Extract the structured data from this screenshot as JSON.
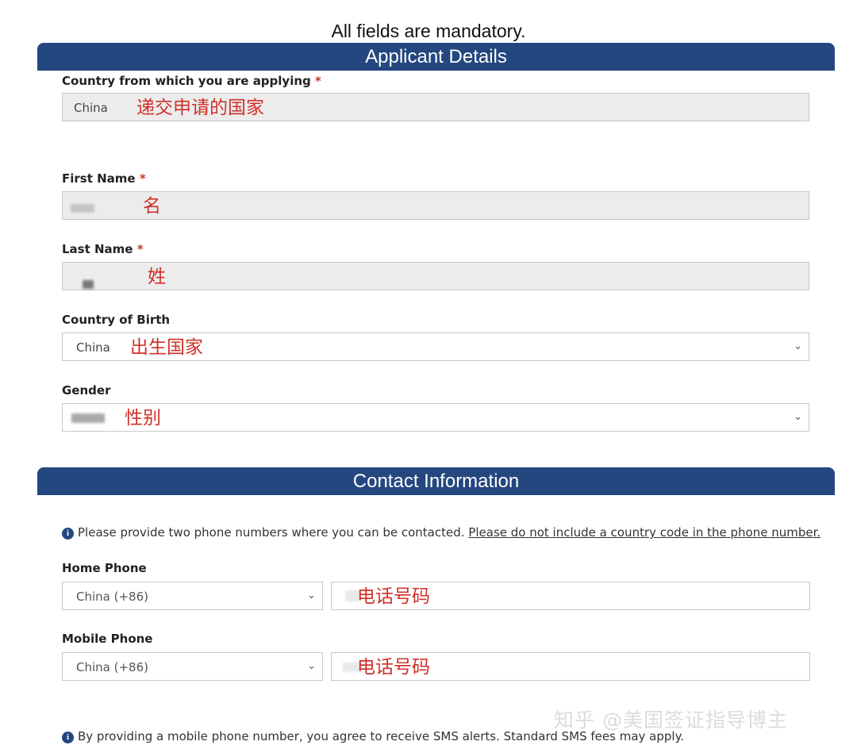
{
  "header": {
    "mandatory_note": "All fields are mandatory."
  },
  "applicant": {
    "section_title": "Applicant Details",
    "country_applying": {
      "label": "Country from which you are applying",
      "required_mark": "*",
      "value": "China",
      "annotation": "递交申请的国家"
    },
    "first_name": {
      "label": "First Name",
      "required_mark": "*",
      "annotation": "名"
    },
    "last_name": {
      "label": "Last Name",
      "required_mark": "*",
      "annotation": "姓"
    },
    "country_of_birth": {
      "label": "Country of Birth",
      "value": "China",
      "annotation": "出生国家"
    },
    "gender": {
      "label": "Gender",
      "annotation": "性别"
    }
  },
  "contact": {
    "section_title": "Contact Information",
    "info_text": "Please provide two phone numbers where you can be contacted.",
    "info_link": "Please do not include a country code in the phone number.",
    "home_phone": {
      "label": "Home Phone",
      "country_code": "China (+86)",
      "annotation": "电话号码"
    },
    "mobile_phone": {
      "label": "Mobile Phone",
      "country_code": "China (+86)",
      "annotation": "电话号码"
    },
    "sms_note": "By providing a mobile phone number, you agree to receive SMS alerts. Standard SMS fees may apply."
  },
  "icons": {
    "info": "info-icon",
    "dropdown": "chevron-down-icon"
  },
  "watermark": "知乎 @美国签证指导博主",
  "colors": {
    "section_bar": "#24477f",
    "annotation": "#d0302a",
    "required": "#c0392b"
  }
}
